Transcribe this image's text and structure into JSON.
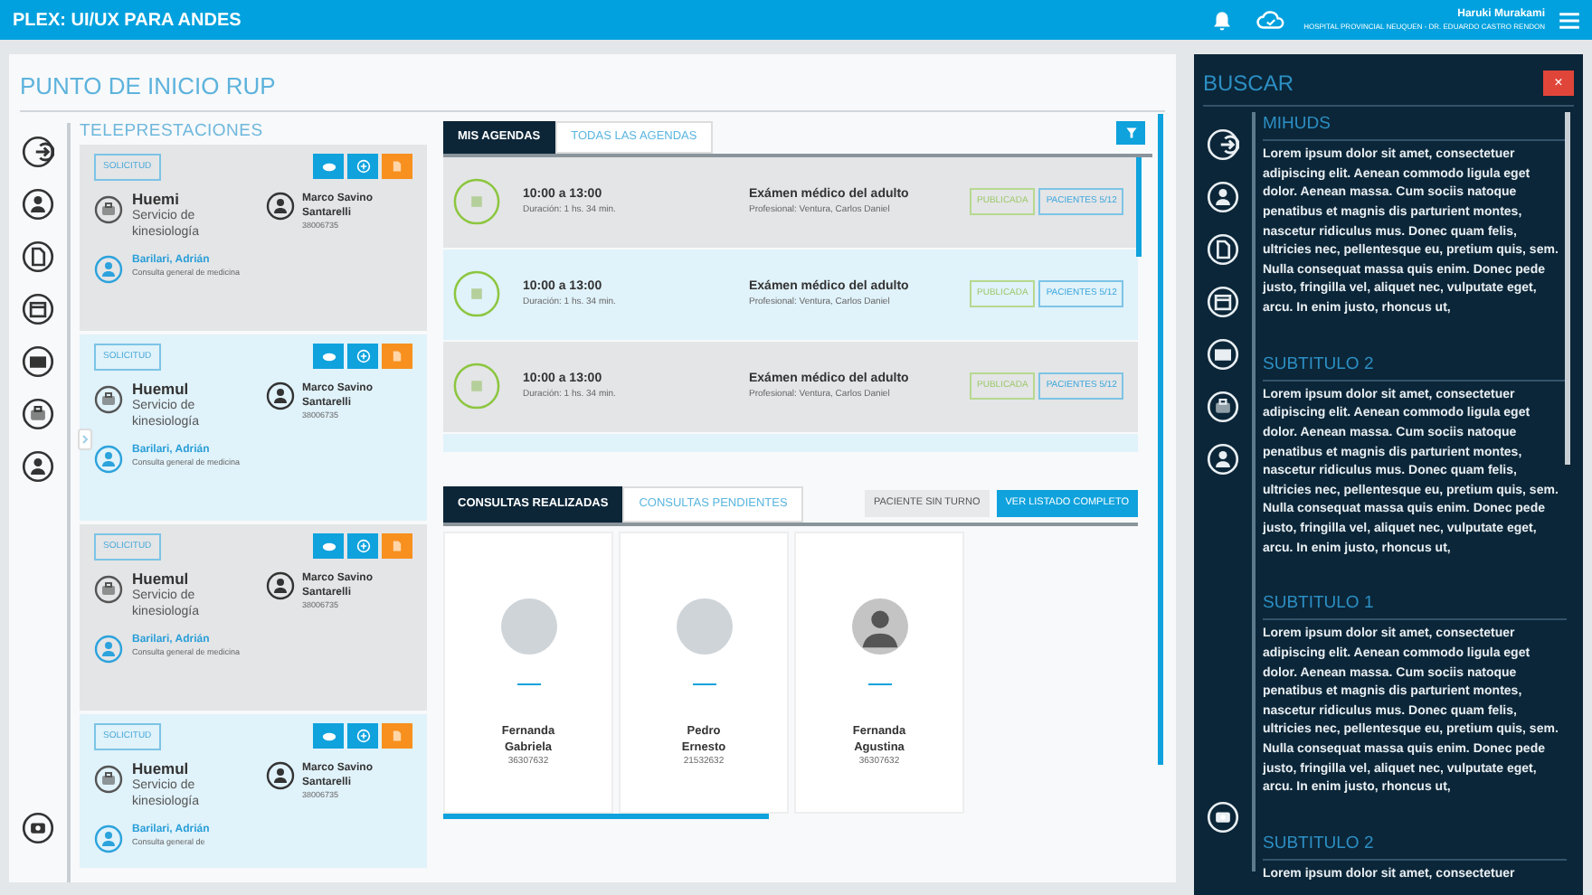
{
  "header": {
    "title": "PLEX: UI/UX PARA ANDES",
    "user_name": "Haruki Murakami",
    "organization": "HOSPITAL PROVINCIAL NEUQUEN - DR. EDUARDO CASTRO RENDON"
  },
  "main": {
    "title": "PUNTO DE INICIO RUP",
    "teleprestaciones": {
      "title": "TELEPRESTACIONES",
      "cards": [
        {
          "badge": "SOLICITUD",
          "place": "Huemi",
          "service": "Servicio de kinesiología",
          "patient": "Marco Savino Santarelli",
          "dni": "38006735",
          "doctor": "Barilari, Adrián",
          "consult": "Consulta general de medicina"
        },
        {
          "badge": "SOLICITUD",
          "place": "Huemul",
          "service": "Servicio de kinesiología",
          "patient": "Marco Savino Santarelli",
          "dni": "38006735",
          "doctor": "Barilari, Adrián",
          "consult": "Consulta general de medicina"
        },
        {
          "badge": "SOLICITUD",
          "place": "Huemul",
          "service": "Servicio de kinesiología",
          "patient": "Marco Savino Santarelli",
          "dni": "38006735",
          "doctor": "Barilari, Adrián",
          "consult": "Consulta general de medicina"
        },
        {
          "badge": "SOLICITUD",
          "place": "Huemul",
          "service": "Servicio de kinesiología",
          "patient": "Marco Savino Santarelli",
          "dni": "38006735",
          "doctor": "Barilari, Adrián",
          "consult": "Consulta general de"
        }
      ]
    },
    "agenda_tabs": [
      {
        "label": "MIS AGENDAS",
        "selected": true
      },
      {
        "label": "TODAS LAS AGENDAS",
        "selected": false
      }
    ],
    "agendas": [
      {
        "time": "10:00 a 13:00",
        "duration": "Duración: 1 hs. 34 min.",
        "title": "Exámen médico del adulto",
        "professional": "Profesional: Ventura, Carlos Daniel",
        "status": "PUBLICADA",
        "patients": "PACIENTES 5/12"
      },
      {
        "time": "10:00 a 13:00",
        "duration": "Duración: 1 hs. 34 min.",
        "title": "Exámen médico del adulto",
        "professional": "Profesional: Ventura, Carlos Daniel",
        "status": "PUBLICADA",
        "patients": "PACIENTES 5/12"
      },
      {
        "time": "10:00 a 13:00",
        "duration": "Duración: 1 hs. 34 min.",
        "title": "Exámen médico del adulto",
        "professional": "Profesional: Ventura, Carlos Daniel",
        "status": "PUBLICADA",
        "patients": "PACIENTES 5/12"
      }
    ],
    "consult_tabs": [
      {
        "label": "CONSULTAS REALIZADAS",
        "selected": true
      },
      {
        "label": "CONSULTAS PENDIENTES",
        "selected": false
      }
    ],
    "consult_buttons": [
      {
        "label": "PACIENTE SIN TURNO",
        "kind": "secondary"
      },
      {
        "label": "VER LISTADO COMPLETO",
        "kind": "primary"
      }
    ],
    "patients": [
      {
        "first_name": "Fernanda",
        "second_name": "Gabriela",
        "dni": "36307632",
        "kind": "photo"
      },
      {
        "first_name": "Pedro",
        "second_name": "Ernesto",
        "dni": "21532632",
        "kind": "photo"
      },
      {
        "first_name": "Fernanda",
        "second_name": "Agustina",
        "dni": "36307632",
        "kind": "silhouette"
      }
    ]
  },
  "search_panel": {
    "title": "BUSCAR",
    "close": "×",
    "sections": [
      {
        "heading": "MIHUDS",
        "text": "Lorem ipsum dolor sit amet, consectetuer adipiscing elit. Aenean commodo ligula eget dolor. Aenean massa. Cum sociis natoque penatibus et magnis dis parturient montes, nascetur ridiculus mus. Donec quam felis, ultricies nec, pellentesque eu, pretium quis, sem. Nulla consequat massa quis enim. Donec pede justo, fringilla vel, aliquet nec, vulputate eget, arcu. In enim justo, rhoncus ut,"
      },
      {
        "heading": "SUBTITULO 2",
        "text": "Lorem ipsum dolor sit amet, consectetuer adipiscing elit. Aenean commodo ligula eget dolor. Aenean massa. Cum sociis natoque penatibus et magnis dis parturient montes, nascetur ridiculus mus. Donec quam felis, ultricies nec, pellentesque eu, pretium quis, sem. Nulla consequat massa quis enim. Donec pede justo, fringilla vel, aliquet nec, vulputate eget, arcu. In enim justo, rhoncus ut,"
      },
      {
        "heading": "SUBTITULO 1",
        "text": "Lorem ipsum dolor sit amet, consectetuer adipiscing elit. Aenean commodo ligula eget dolor. Aenean massa. Cum sociis natoque penatibus et magnis dis parturient montes, nascetur ridiculus mus. Donec quam felis, ultricies nec, pellentesque eu, pretium quis, sem. Nulla consequat massa quis enim. Donec pede justo, fringilla vel, aliquet nec, vulputate eget, arcu. In enim justo, rhoncus ut,"
      },
      {
        "heading": "SUBTITULO 2",
        "text": "Lorem ipsum dolor sit amet, consectetuer"
      }
    ]
  }
}
